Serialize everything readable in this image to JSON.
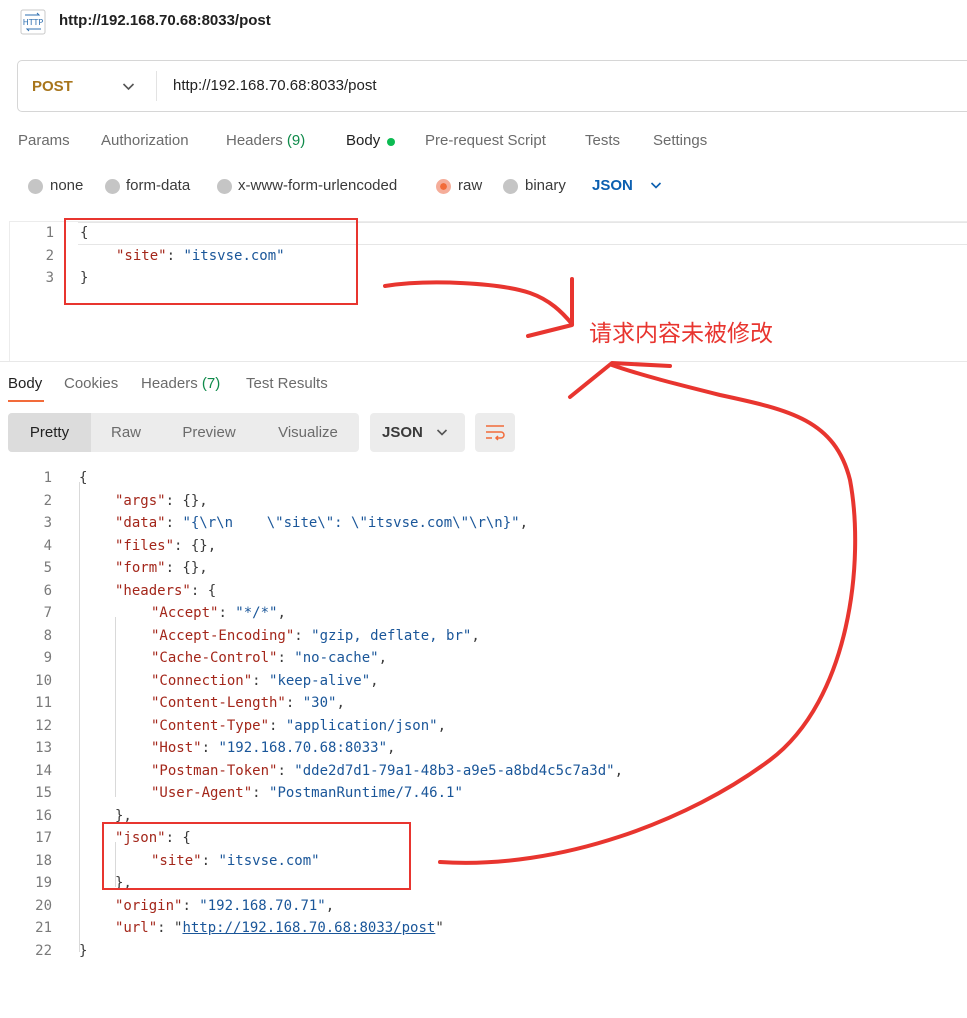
{
  "window": {
    "title": "http://192.168.70.68:8033/post",
    "icon": "http-icon"
  },
  "request": {
    "method": "POST",
    "url": "http://192.168.70.68:8033/post",
    "tabs": [
      {
        "label": "Params"
      },
      {
        "label": "Authorization"
      },
      {
        "label": "Headers",
        "count": "(9)"
      },
      {
        "label": "Body",
        "active": true
      },
      {
        "label": "Pre-request Script"
      },
      {
        "label": "Tests"
      },
      {
        "label": "Settings"
      }
    ],
    "body_types": [
      {
        "label": "none"
      },
      {
        "label": "form-data"
      },
      {
        "label": "x-www-form-urlencoded"
      },
      {
        "label": "raw",
        "selected": true
      },
      {
        "label": "binary"
      }
    ],
    "format": "JSON",
    "body_lines": [
      {
        "num": "1",
        "text": "{"
      },
      {
        "num": "2",
        "key": "\"site\"",
        "value": "\"itsvse.com\""
      },
      {
        "num": "3",
        "text": "}"
      }
    ]
  },
  "response": {
    "tabs": [
      {
        "label": "Body",
        "active": true
      },
      {
        "label": "Cookies"
      },
      {
        "label": "Headers",
        "count": "(7)"
      },
      {
        "label": "Test Results"
      }
    ],
    "view_modes": [
      "Pretty",
      "Raw",
      "Preview",
      "Visualize"
    ],
    "active_view": "Pretty",
    "format": "JSON",
    "lines": [
      {
        "num": "1",
        "indent": 0,
        "parts": [
          [
            "p",
            "{"
          ]
        ]
      },
      {
        "num": "2",
        "indent": 1,
        "parts": [
          [
            "k",
            "\"args\""
          ],
          [
            "p",
            ": {},"
          ]
        ]
      },
      {
        "num": "3",
        "indent": 1,
        "parts": [
          [
            "k",
            "\"data\""
          ],
          [
            "p",
            ": "
          ],
          [
            "s",
            "\"{\\r\\n    \\\"site\\\": \\\"itsvse.com\\\"\\r\\n}\""
          ],
          [
            "p",
            ","
          ]
        ]
      },
      {
        "num": "4",
        "indent": 1,
        "parts": [
          [
            "k",
            "\"files\""
          ],
          [
            "p",
            ": {},"
          ]
        ]
      },
      {
        "num": "5",
        "indent": 1,
        "parts": [
          [
            "k",
            "\"form\""
          ],
          [
            "p",
            ": {},"
          ]
        ]
      },
      {
        "num": "6",
        "indent": 1,
        "parts": [
          [
            "k",
            "\"headers\""
          ],
          [
            "p",
            ": {"
          ]
        ]
      },
      {
        "num": "7",
        "indent": 2,
        "parts": [
          [
            "k",
            "\"Accept\""
          ],
          [
            "p",
            ": "
          ],
          [
            "s",
            "\"*/*\""
          ],
          [
            "p",
            ","
          ]
        ]
      },
      {
        "num": "8",
        "indent": 2,
        "parts": [
          [
            "k",
            "\"Accept-Encoding\""
          ],
          [
            "p",
            ": "
          ],
          [
            "s",
            "\"gzip, deflate, br\""
          ],
          [
            "p",
            ","
          ]
        ]
      },
      {
        "num": "9",
        "indent": 2,
        "parts": [
          [
            "k",
            "\"Cache-Control\""
          ],
          [
            "p",
            ": "
          ],
          [
            "s",
            "\"no-cache\""
          ],
          [
            "p",
            ","
          ]
        ]
      },
      {
        "num": "10",
        "indent": 2,
        "parts": [
          [
            "k",
            "\"Connection\""
          ],
          [
            "p",
            ": "
          ],
          [
            "s",
            "\"keep-alive\""
          ],
          [
            "p",
            ","
          ]
        ]
      },
      {
        "num": "11",
        "indent": 2,
        "parts": [
          [
            "k",
            "\"Content-Length\""
          ],
          [
            "p",
            ": "
          ],
          [
            "s",
            "\"30\""
          ],
          [
            "p",
            ","
          ]
        ]
      },
      {
        "num": "12",
        "indent": 2,
        "parts": [
          [
            "k",
            "\"Content-Type\""
          ],
          [
            "p",
            ": "
          ],
          [
            "s",
            "\"application/json\""
          ],
          [
            "p",
            ","
          ]
        ]
      },
      {
        "num": "13",
        "indent": 2,
        "parts": [
          [
            "k",
            "\"Host\""
          ],
          [
            "p",
            ": "
          ],
          [
            "s",
            "\"192.168.70.68:8033\""
          ],
          [
            "p",
            ","
          ]
        ]
      },
      {
        "num": "14",
        "indent": 2,
        "parts": [
          [
            "k",
            "\"Postman-Token\""
          ],
          [
            "p",
            ": "
          ],
          [
            "s",
            "\"dde2d7d1-79a1-48b3-a9e5-a8bd4c5c7a3d\""
          ],
          [
            "p",
            ","
          ]
        ]
      },
      {
        "num": "15",
        "indent": 2,
        "parts": [
          [
            "k",
            "\"User-Agent\""
          ],
          [
            "p",
            ": "
          ],
          [
            "s",
            "\"PostmanRuntime/7.46.1\""
          ]
        ]
      },
      {
        "num": "16",
        "indent": 1,
        "parts": [
          [
            "p",
            "},"
          ]
        ]
      },
      {
        "num": "17",
        "indent": 1,
        "parts": [
          [
            "k",
            "\"json\""
          ],
          [
            "p",
            ": {"
          ]
        ]
      },
      {
        "num": "18",
        "indent": 2,
        "parts": [
          [
            "k",
            "\"site\""
          ],
          [
            "p",
            ": "
          ],
          [
            "s",
            "\"itsvse.com\""
          ]
        ]
      },
      {
        "num": "19",
        "indent": 1,
        "parts": [
          [
            "p",
            "},"
          ]
        ]
      },
      {
        "num": "20",
        "indent": 1,
        "parts": [
          [
            "k",
            "\"origin\""
          ],
          [
            "p",
            ": "
          ],
          [
            "s",
            "\"192.168.70.71\""
          ],
          [
            "p",
            ","
          ]
        ]
      },
      {
        "num": "21",
        "indent": 1,
        "parts": [
          [
            "k",
            "\"url\""
          ],
          [
            "p",
            ": \""
          ],
          [
            "u",
            "http://192.168.70.68:8033/post"
          ],
          [
            "p",
            "\""
          ]
        ]
      },
      {
        "num": "22",
        "indent": 0,
        "parts": [
          [
            "p",
            "}"
          ]
        ]
      }
    ]
  },
  "annotation": {
    "text": "请求内容未被修改",
    "color": "#e8352f"
  },
  "colors": {
    "accent": "#f26b3a",
    "method": "#a8751b",
    "json_key": "#a3261a",
    "json_string": "#1a5699",
    "count_green": "#0f8a4a"
  }
}
